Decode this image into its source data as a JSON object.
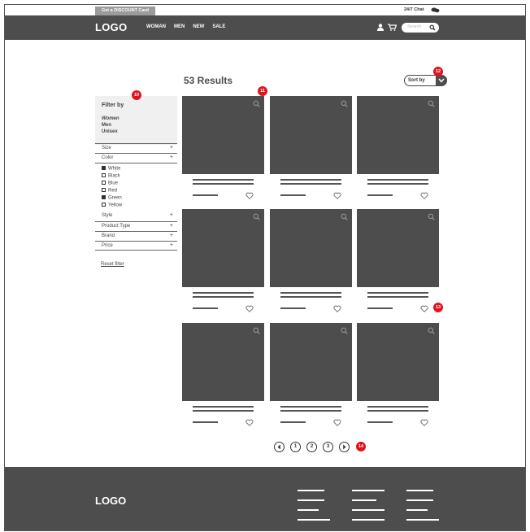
{
  "topbar": {
    "discount_label": "Get a DISCOUNT Card",
    "chat_label": "24/7 Chat"
  },
  "header": {
    "logo": "LOGO",
    "nav": [
      "WOMAN",
      "MEN",
      "NEW",
      "SALE"
    ],
    "search_placeholder": "Search"
  },
  "results": {
    "count_label": "53 Results",
    "sort_label": "Sort by"
  },
  "filters": {
    "title": "Filter by",
    "genders": [
      {
        "label": "Women",
        "selected": true
      },
      {
        "label": "Men",
        "selected": false
      },
      {
        "label": "Unisex",
        "selected": false
      }
    ],
    "size_label": "Size",
    "color_label": "Color",
    "colors": [
      {
        "label": "White",
        "checked": true
      },
      {
        "label": "Black",
        "checked": false
      },
      {
        "label": "Blue",
        "checked": false
      },
      {
        "label": "Red",
        "checked": false
      },
      {
        "label": "Green",
        "checked": true
      },
      {
        "label": "Yellow",
        "checked": false
      }
    ],
    "more": [
      "Style",
      "Product Type",
      "Brand",
      "Price"
    ],
    "expand_symbol": "+",
    "reset_label": "Reset filter"
  },
  "badges": [
    "10",
    "11",
    "12",
    "13",
    "14"
  ],
  "pagination": {
    "pages": [
      "1",
      "2",
      "3"
    ]
  },
  "footer": {
    "logo": "LOGO"
  },
  "colors": {
    "dark": "#4d4d4d",
    "badge": "#e0141e",
    "sidebar_bg": "#f0f0f0"
  }
}
